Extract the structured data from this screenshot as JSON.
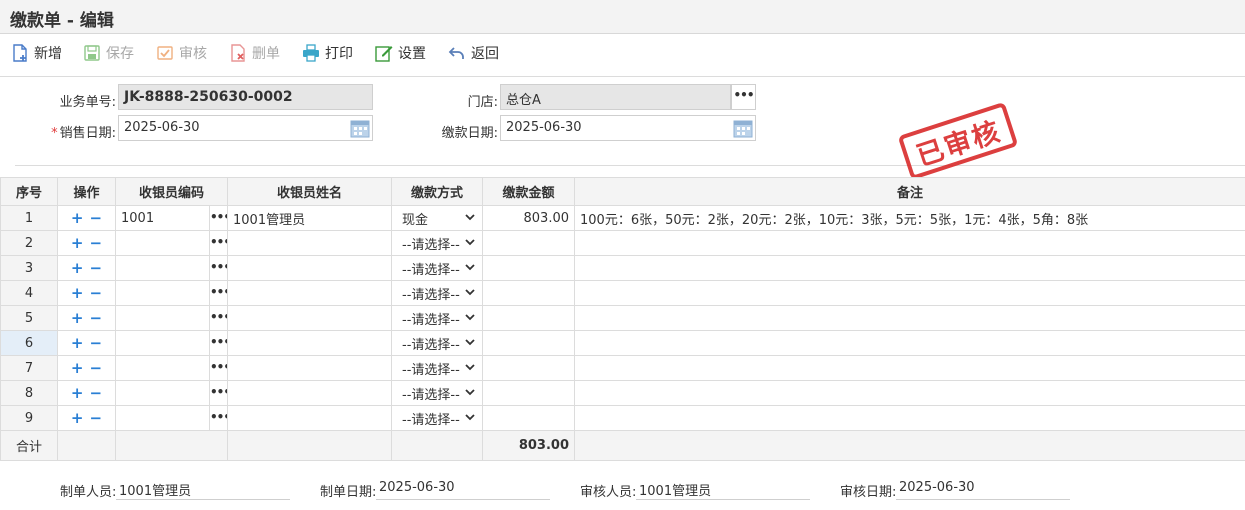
{
  "page": {
    "title": "缴款单 - 编辑"
  },
  "toolbar": {
    "new_label": "新增",
    "save_label": "保存",
    "audit_label": "审核",
    "delete_label": "删单",
    "print_label": "打印",
    "settings_label": "设置",
    "back_label": "返回"
  },
  "form": {
    "doc_no_label": "业务单号:",
    "doc_no_value": "JK-8888-250630-0002",
    "store_label": "门店:",
    "store_value": "总仓A",
    "store_picker": "•••",
    "sale_date_required": "*",
    "sale_date_label": "销售日期:",
    "sale_date_value": "2025-06-30",
    "pay_date_label": "缴款日期:",
    "pay_date_value": "2025-06-30"
  },
  "stamp": {
    "text": "已审核"
  },
  "table": {
    "headers": [
      "序号",
      "操作",
      "收银员编码",
      "收银员姓名",
      "缴款方式",
      "缴款金额",
      "备注"
    ],
    "rows": [
      {
        "idx": "1",
        "code": "1001",
        "name": "1001管理员",
        "method": "现金",
        "amount": "803.00",
        "remark": "100元：6张，50元：2张，20元：2张，10元：3张，5元：5张，1元：4张，5角：8张"
      },
      {
        "idx": "2",
        "code": "",
        "name": "",
        "method": "--请选择--",
        "amount": "",
        "remark": ""
      },
      {
        "idx": "3",
        "code": "",
        "name": "",
        "method": "--请选择--",
        "amount": "",
        "remark": ""
      },
      {
        "idx": "4",
        "code": "",
        "name": "",
        "method": "--请选择--",
        "amount": "",
        "remark": ""
      },
      {
        "idx": "5",
        "code": "",
        "name": "",
        "method": "--请选择--",
        "amount": "",
        "remark": ""
      },
      {
        "idx": "6",
        "code": "",
        "name": "",
        "method": "--请选择--",
        "amount": "",
        "remark": ""
      },
      {
        "idx": "7",
        "code": "",
        "name": "",
        "method": "--请选择--",
        "amount": "",
        "remark": ""
      },
      {
        "idx": "8",
        "code": "",
        "name": "",
        "method": "--请选择--",
        "amount": "",
        "remark": ""
      },
      {
        "idx": "9",
        "code": "",
        "name": "",
        "method": "--请选择--",
        "amount": "",
        "remark": ""
      }
    ],
    "op_plus": "+",
    "op_minus": "−",
    "cell_picker": "•••",
    "total_label": "合计",
    "total_amount": "803.00"
  },
  "footer": {
    "creator_label": "制单人员:",
    "creator_value": "1001管理员",
    "create_date_label": "制单日期:",
    "create_date_value": "2025-06-30",
    "auditor_label": "审核人员:",
    "auditor_value": "1001管理员",
    "audit_date_label": "审核日期:",
    "audit_date_value": "2025-06-30"
  },
  "colors": {
    "accent_blue": "#2a7fd4",
    "stamp_red": "#d92b2b",
    "header_bg": "#f4f4f4",
    "readonly_bg": "#e6e6e6"
  }
}
